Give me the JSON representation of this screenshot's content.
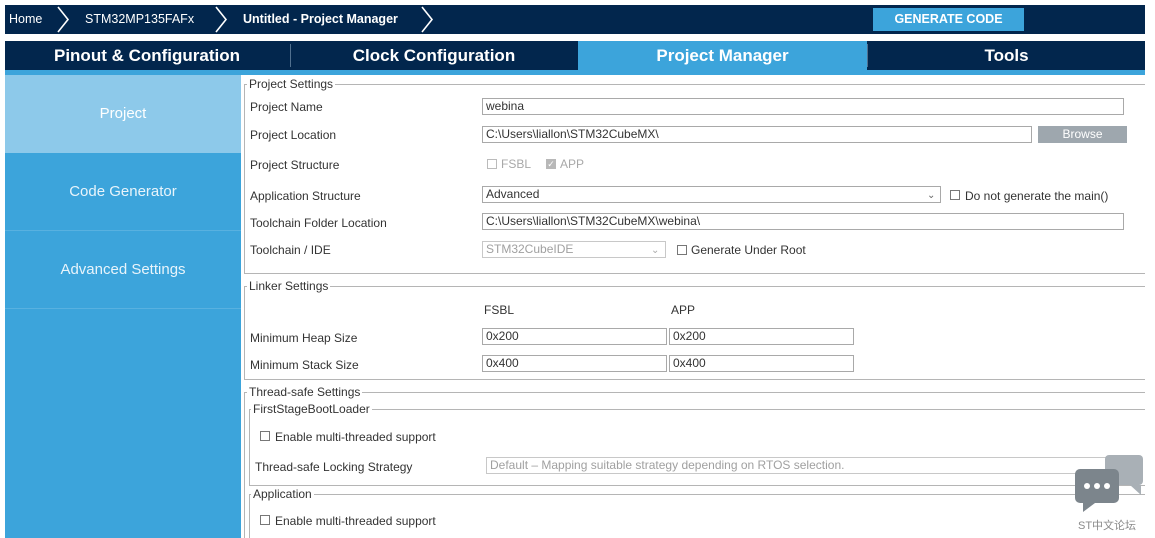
{
  "breadcrumb": {
    "home": "Home",
    "device": "STM32MP135FAFx",
    "project": "Untitled - Project Manager"
  },
  "toolbar": {
    "generate_label": "GENERATE CODE"
  },
  "tabs": [
    {
      "label": "Pinout & Configuration",
      "active": false
    },
    {
      "label": "Clock Configuration",
      "active": false
    },
    {
      "label": "Project Manager",
      "active": true
    },
    {
      "label": "Tools",
      "active": false
    }
  ],
  "sidebar": {
    "items": [
      {
        "label": "Project",
        "active": true
      },
      {
        "label": "Code Generator",
        "active": false
      },
      {
        "label": "Advanced Settings",
        "active": false
      }
    ]
  },
  "project_settings": {
    "legend": "Project Settings",
    "name_label": "Project Name",
    "name_value": "webina",
    "location_label": "Project Location",
    "location_value": "C:\\Users\\liallon\\STM32CubeMX\\",
    "browse_label": "Browse",
    "structure_label": "Project Structure",
    "structure_fsbl": "FSBL",
    "structure_app": "APP",
    "app_structure_label": "Application Structure",
    "app_structure_value": "Advanced",
    "no_main_label": "Do not generate the main()",
    "toolchain_folder_label": "Toolchain Folder Location",
    "toolchain_folder_value": "C:\\Users\\liallon\\STM32CubeMX\\webina\\",
    "toolchain_label": "Toolchain / IDE",
    "toolchain_value": "STM32CubeIDE",
    "generate_under_root_label": "Generate Under Root"
  },
  "linker_settings": {
    "legend": "Linker Settings",
    "col_fsbl": "FSBL",
    "col_app": "APP",
    "heap_label": "Minimum Heap Size",
    "heap_fsbl": "0x200",
    "heap_app": "0x200",
    "stack_label": "Minimum Stack Size",
    "stack_fsbl": "0x400",
    "stack_app": "0x400"
  },
  "thread_safe": {
    "legend": "Thread-safe Settings",
    "fsbl_legend": "FirstStageBootLoader",
    "fsbl_multithread_label": "Enable multi-threaded support",
    "locking_label": "Thread-safe Locking Strategy",
    "locking_value": "Default – Mapping suitable strategy depending on RTOS selection.",
    "app_legend": "Application",
    "app_multithread_label": "Enable multi-threaded support"
  },
  "watermark": {
    "text": "ST中文论坛"
  },
  "colors": {
    "navy": "#02264d",
    "accent_blue": "#3ca4db",
    "sidebar_active": "#8dc9ea",
    "browse_gray": "#9ea7ae"
  }
}
